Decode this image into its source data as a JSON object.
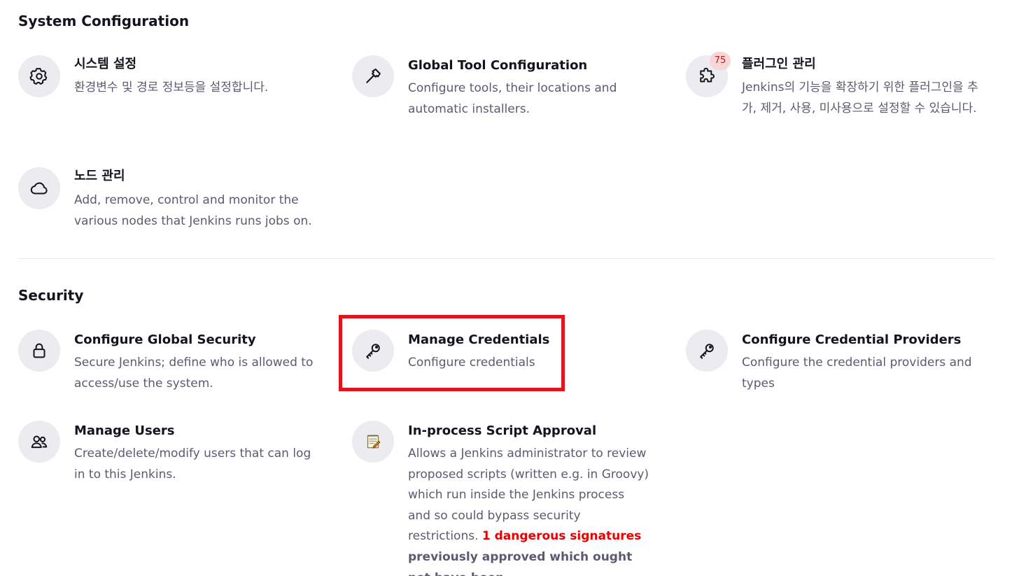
{
  "sections": {
    "system_configuration": {
      "title": "System Configuration",
      "items": [
        {
          "icon": "gear-icon",
          "title": "시스템 설정",
          "description": "환경변수 및 경로 정보등을 설정합니다."
        },
        {
          "icon": "hammer-icon",
          "title": "Global Tool Configuration",
          "description": "Configure tools, their locations and automatic installers."
        },
        {
          "icon": "puzzle-icon",
          "title": "플러그인 관리",
          "description": "Jenkins의 기능을 확장하기 위한 플러그인을 추가, 제거, 사용, 미사용으로 설정할 수 있습니다.",
          "badge": "75"
        },
        {
          "icon": "cloud-icon",
          "title": "노드 관리",
          "description": "Add, remove, control and monitor the various nodes that Jenkins runs jobs on."
        }
      ]
    },
    "security": {
      "title": "Security",
      "items": [
        {
          "icon": "lock-icon",
          "title": "Configure Global Security",
          "description": "Secure Jenkins; define who is allowed to access/use the system."
        },
        {
          "icon": "key-icon",
          "title": "Manage Credentials",
          "description": "Configure credentials"
        },
        {
          "icon": "key-icon",
          "title": "Configure Credential Providers",
          "description": "Configure the credential providers and types"
        },
        {
          "icon": "users-icon",
          "title": "Manage Users",
          "description": "Create/delete/modify users that can log in to this Jenkins."
        },
        {
          "icon": "notepad-icon",
          "title": "In-process Script Approval",
          "description": "Allows a Jenkins administrator to review proposed scripts (written e.g. in Groovy) which run inside the Jenkins process and so could bypass security restrictions.",
          "danger_text": "1 dangerous signatures",
          "warning_text": "previously approved which ought not have been."
        }
      ]
    }
  },
  "colors": {
    "title_text": "#14141f",
    "description_text": "#5b5b70",
    "icon_background": "#ebebf0",
    "badge_background": "#f6d6d6",
    "badge_text": "#b51d1d",
    "danger_text": "#e60000",
    "highlight_border": "#e3131b",
    "divider": "#e8e8ec"
  }
}
